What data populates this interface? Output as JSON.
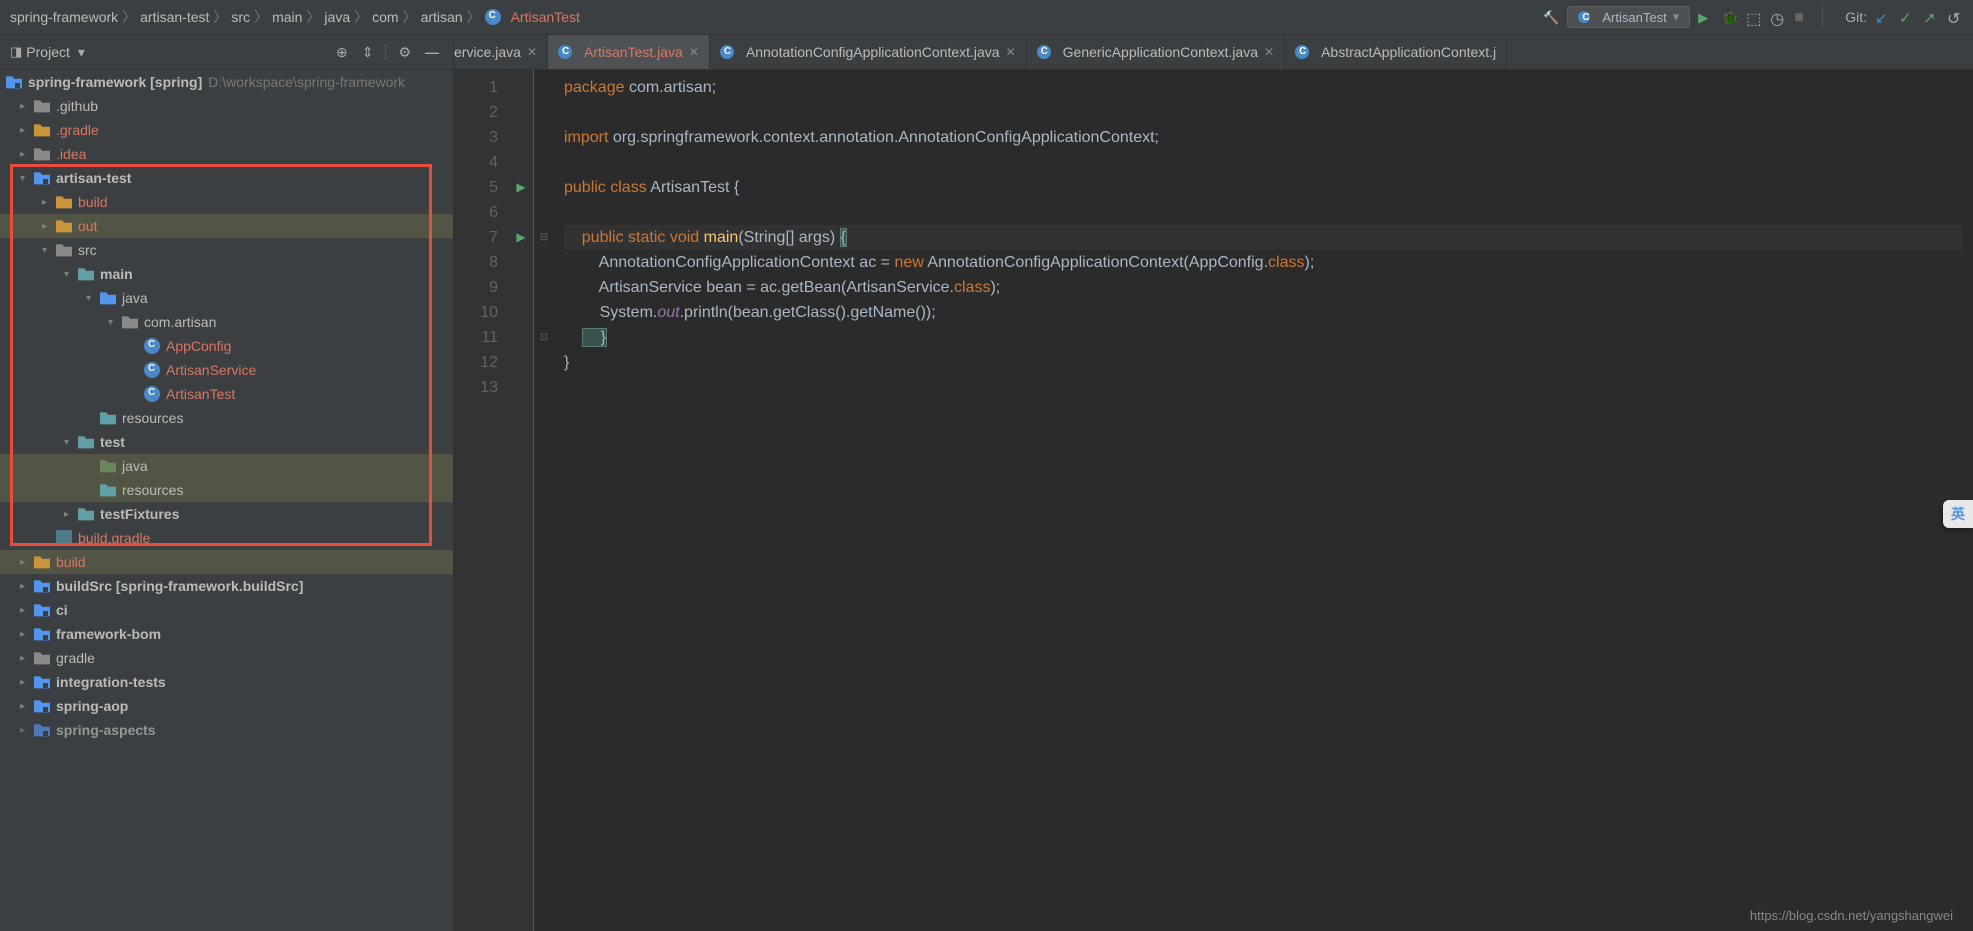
{
  "breadcrumb": [
    "spring-framework",
    "artisan-test",
    "src",
    "main",
    "java",
    "com",
    "artisan",
    "ArtisanTest"
  ],
  "runConfig": "ArtisanTest",
  "gitLabel": "Git:",
  "sidebarTitle": "Project",
  "projectRoot": {
    "name": "spring-framework [spring]",
    "path": "D:\\workspace\\spring-framework"
  },
  "tree": {
    "n0": ".github",
    "n1": ".gradle",
    "n2": ".idea",
    "n3": "artisan-test",
    "n3_0": "build",
    "n3_1": "out",
    "n3_2": "src",
    "n3_2_0": "main",
    "n3_2_0_0": "java",
    "n3_2_0_0_0": "com.artisan",
    "n3_2_0_0_0_0": "AppConfig",
    "n3_2_0_0_0_1": "ArtisanService",
    "n3_2_0_0_0_2": "ArtisanTest",
    "n3_2_0_1": "resources",
    "n3_2_1": "test",
    "n3_2_1_0": "java",
    "n3_2_1_1": "resources",
    "n3_2_2": "testFixtures",
    "n3_3": "build.gradle",
    "n4": "build",
    "n5": "buildSrc [spring-framework.buildSrc]",
    "n6": "ci",
    "n7": "framework-bom",
    "n8": "gradle",
    "n9": "integration-tests",
    "n10": "spring-aop",
    "n11": "spring-aspects"
  },
  "tabs": [
    {
      "label": "ervice.java",
      "partial": true
    },
    {
      "label": "ArtisanTest.java",
      "active": true
    },
    {
      "label": "AnnotationConfigApplicationContext.java"
    },
    {
      "label": "GenericApplicationContext.java"
    },
    {
      "label": "AbstractApplicationContext.j",
      "noclose": true
    }
  ],
  "code": {
    "l1": {
      "kw": "package",
      "rest": " com.artisan;"
    },
    "l3": {
      "kw": "import",
      "rest": " org.springframework.context.annotation.AnnotationConfigApplicationContext;"
    },
    "l5": {
      "p1": "public class ",
      "cls": "ArtisanTest",
      "p2": " {"
    },
    "l7": {
      "mods": "public static void ",
      "fn": "main",
      "args": "(String[] args) ",
      "br": "{"
    },
    "l8": "        AnnotationConfigApplicationContext ac = ",
    "l8new": "new",
    "l8b": " AnnotationConfigApplicationContext(AppConfig.",
    "l8c": "class",
    "l8d": ");",
    "l9": "        ArtisanService bean = ac.getBean(ArtisanService.",
    "l9c": "class",
    "l9d": ");",
    "l10a": "        System.",
    "l10b": "out",
    "l10c": ".println(bean.getClass().getName());",
    "l11": "    }",
    "l12": "}"
  },
  "lineNumbers": [
    1,
    2,
    3,
    4,
    5,
    6,
    7,
    8,
    9,
    10,
    11,
    12,
    13
  ],
  "watermark": "https://blog.csdn.net/yangshangwei",
  "langBadge": "英"
}
